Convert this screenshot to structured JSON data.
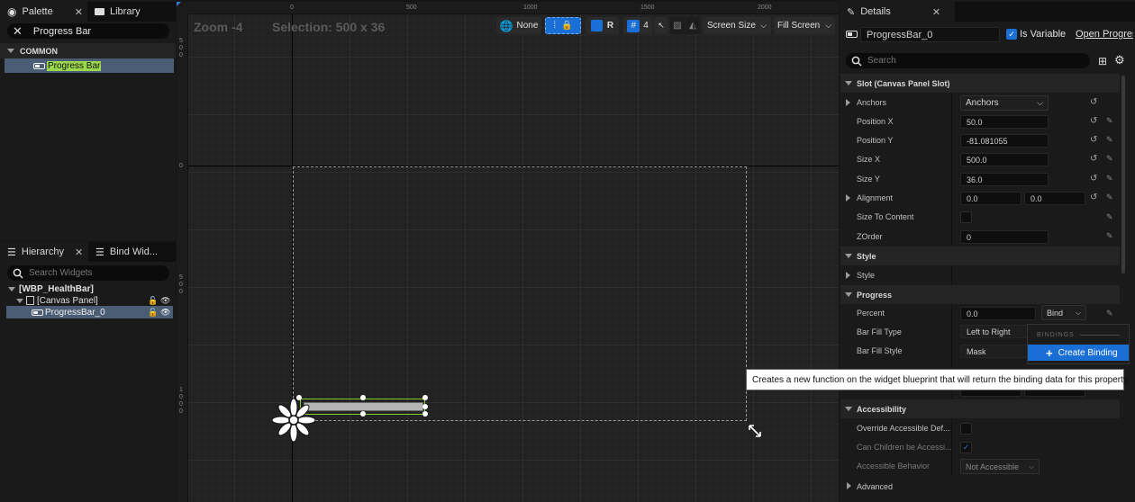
{
  "palette": {
    "tab_label": "Palette",
    "library_tab_label": "Library",
    "search_value": "Progress Bar",
    "category": "COMMON",
    "item": "Progress Bar"
  },
  "hierarchy": {
    "tab_label": "Hierarchy",
    "bind_tab_label": "Bind Wid...",
    "search_placeholder": "Search Widgets",
    "root": "[WBP_HealthBar]",
    "canvas": "[Canvas Panel]",
    "child": "ProgressBar_0"
  },
  "designer": {
    "zoom": "Zoom -4",
    "selection": "Selection: 500 x 36",
    "ruler_top": [
      "0",
      "500",
      "1000",
      "1500",
      "2000"
    ],
    "ruler_left": [
      [
        "5",
        "0",
        "0"
      ],
      [
        "0"
      ],
      [
        "5",
        "0",
        "0"
      ],
      [
        "1",
        "0",
        "0",
        "0"
      ]
    ],
    "toolbar": {
      "none_label": "None",
      "r_label": "R",
      "grid_value": "4",
      "screen_size": "Screen Size",
      "fill_screen": "Fill Screen"
    }
  },
  "details": {
    "tab_label": "Details",
    "widget_name": "ProgressBar_0",
    "is_variable_label": "Is Variable",
    "open_link": "Open Progres",
    "search_placeholder": "Search",
    "slot_section": "Slot (Canvas Panel Slot)",
    "props": {
      "anchors_label": "Anchors",
      "anchors_value": "Anchors",
      "position_x_label": "Position X",
      "position_x": "50.0",
      "position_y_label": "Position Y",
      "position_y": "-81.081055",
      "size_x_label": "Size X",
      "size_x": "500.0",
      "size_y_label": "Size Y",
      "size_y": "36.0",
      "alignment_label": "Alignment",
      "alignment_x": "0.0",
      "alignment_y": "0.0",
      "size_to_content_label": "Size To Content",
      "zorder_label": "ZOrder",
      "zorder": "0"
    },
    "style_section": "Style",
    "style_label": "Style",
    "progress_section": "Progress",
    "percent_label": "Percent",
    "percent_value": "0.0",
    "bind_label": "Bind",
    "bar_fill_type_label": "Bar Fill Type",
    "bar_fill_type_value": "Left to Right",
    "bar_fill_style_label": "Bar Fill Style",
    "bar_fill_style_value": "Mask",
    "accessibility_section": "Accessibility",
    "override_label": "Override Accessible Def...",
    "children_label": "Can Children be Accessi...",
    "behavior_label": "Accessible Behavior",
    "behavior_value": "Not Accessible",
    "advanced_label": "Advanced"
  },
  "bindings_menu": {
    "header": "BINDINGS",
    "create_label": "Create Binding"
  },
  "tooltip": "Creates a new function on the widget blueprint that will return the binding data for this property.",
  "colors": {
    "accent_blue": "#1a6fd6",
    "selection_green": "#7bd02a",
    "highlight_yellow": "#b8e05a"
  }
}
